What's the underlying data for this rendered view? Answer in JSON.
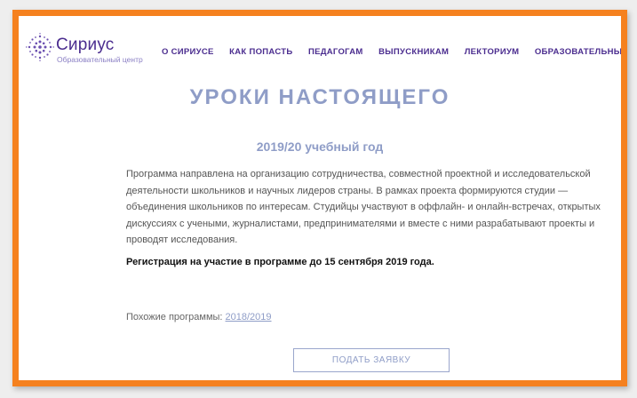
{
  "header": {
    "logo_name": "Сириус",
    "logo_subtitle": "Образовательный центр",
    "nav": [
      {
        "label": "О СИРИУСЕ"
      },
      {
        "label": "КАК ПОПАСТЬ"
      },
      {
        "label": "ПЕДАГОГАМ"
      },
      {
        "label": "ВЫПУСКНИКАМ"
      },
      {
        "label": "ЛЕКТОРИУМ"
      },
      {
        "label": "ОБРАЗОВАТЕЛЬНЫЕ"
      }
    ]
  },
  "main": {
    "title": "УРОКИ НАСТОЯЩЕГО",
    "year": "2019/20 учебный год",
    "description": "Программа направлена на организацию сотрудничества, совместной проектной и исследовательской деятельности школьников и научных лидеров страны. В рамках проекта формируются студии — объединения школьников по интересам. Студийцы участвуют в оффлайн- и онлайн-встречах, открытых дискуссиях с учеными, журналистами, предпринимателями и вместе с ними разрабатывают проекты и проводят исследования.",
    "registration": "Регистрация на участие в программе до 15 сентября 2019 года.",
    "similar_label": "Похожие программы: ",
    "similar_link": "2018/2019",
    "apply_button": "ПОДАТЬ ЗАЯВКУ"
  },
  "colors": {
    "frame": "#f5811f",
    "brand": "#4b2d8f",
    "accent": "#8f9dc7"
  },
  "icons": {
    "logo": "sirius-dots-logo-icon"
  }
}
